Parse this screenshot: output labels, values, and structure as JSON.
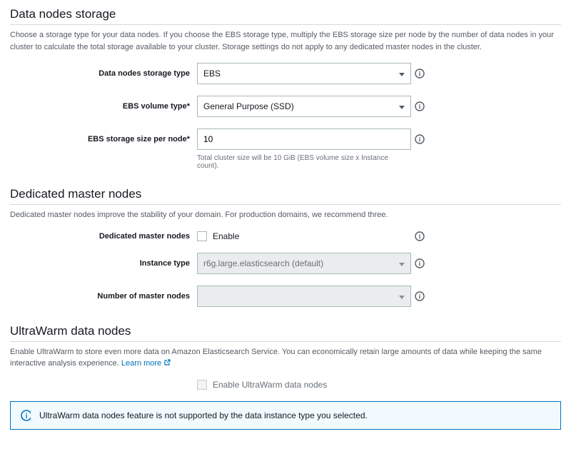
{
  "storage": {
    "title": "Data nodes storage",
    "desc": "Choose a storage type for your data nodes. If you choose the EBS storage type, multiply the EBS storage size per node by the number of data nodes in your cluster to calculate the total storage available to your cluster. Storage settings do not apply to any dedicated master nodes in the cluster.",
    "fields": {
      "storageType": {
        "label": "Data nodes storage type",
        "value": "EBS"
      },
      "volumeType": {
        "label": "EBS volume type*",
        "value": "General Purpose (SSD)"
      },
      "size": {
        "label": "EBS storage size per node*",
        "value": "10",
        "note": "Total cluster size will be 10 GiB (EBS volume size x Instance count)."
      }
    }
  },
  "master": {
    "title": "Dedicated master nodes",
    "desc": "Dedicated master nodes improve the stability of your domain. For production domains, we recommend three.",
    "fields": {
      "enable": {
        "label": "Dedicated master nodes",
        "checkbox": "Enable"
      },
      "instanceType": {
        "label": "Instance type",
        "value": "r6g.large.elasticsearch (default)"
      },
      "count": {
        "label": "Number of master nodes",
        "value": ""
      }
    }
  },
  "ultrawarm": {
    "title": "UltraWarm data nodes",
    "desc": "Enable UltraWarm to store even more data on Amazon Elasticsearch Service. You can economically retain large amounts of data while keeping the same interactive analysis experience. ",
    "learnMore": "Learn more",
    "enableLabel": "Enable UltraWarm data nodes",
    "alert": "UltraWarm data nodes feature is not supported by the data instance type you selected."
  }
}
